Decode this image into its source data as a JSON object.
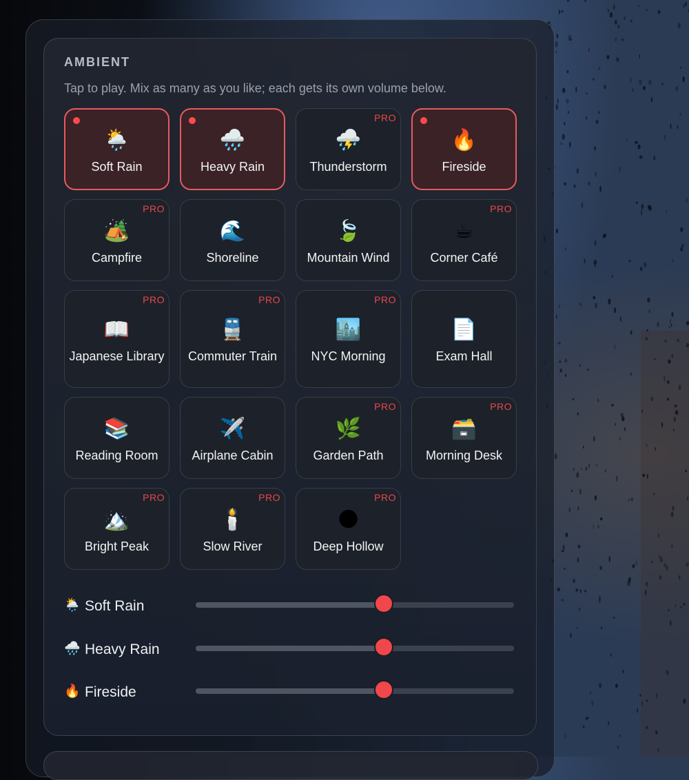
{
  "panel": {
    "title": "AMBIENT",
    "subtitle": "Tap to play. Mix as many as you like; each gets its own volume below."
  },
  "tiles": [
    {
      "emoji": "🌦️",
      "icon": "sun-rain-icon",
      "name": "Soft Rain",
      "active": true,
      "pro": false
    },
    {
      "emoji": "🌧️",
      "icon": "rain-cloud-icon",
      "name": "Heavy Rain",
      "active": true,
      "pro": false
    },
    {
      "emoji": "⛈️",
      "icon": "thunder-cloud-icon",
      "name": "Thunderstorm",
      "active": false,
      "pro": true
    },
    {
      "emoji": "🔥",
      "icon": "fire-icon",
      "name": "Fireside",
      "active": true,
      "pro": false
    },
    {
      "emoji": "🏕️",
      "icon": "camping-icon",
      "name": "Campfire",
      "active": false,
      "pro": true
    },
    {
      "emoji": "🌊",
      "icon": "wave-icon",
      "name": "Shoreline",
      "active": false,
      "pro": false
    },
    {
      "emoji": "🍃",
      "icon": "leaves-icon",
      "name": "Mountain Wind",
      "active": false,
      "pro": false
    },
    {
      "emoji": "☕",
      "icon": "coffee-icon",
      "name": "Corner Café",
      "active": false,
      "pro": true
    },
    {
      "emoji": "📖",
      "icon": "book-icon",
      "name": "Japanese Library",
      "active": false,
      "pro": true
    },
    {
      "emoji": "🚆",
      "icon": "train-icon",
      "name": "Commuter Train",
      "active": false,
      "pro": true
    },
    {
      "emoji": "🏙️",
      "icon": "cityscape-icon",
      "name": "NYC Morning",
      "active": false,
      "pro": true
    },
    {
      "emoji": "📄",
      "icon": "page-icon",
      "name": "Exam Hall",
      "active": false,
      "pro": false
    },
    {
      "emoji": "📚",
      "icon": "books-icon",
      "name": "Reading Room",
      "active": false,
      "pro": false
    },
    {
      "emoji": "✈️",
      "icon": "airplane-icon",
      "name": "Airplane Cabin",
      "active": false,
      "pro": false
    },
    {
      "emoji": "🌿",
      "icon": "herb-icon",
      "name": "Garden Path",
      "active": false,
      "pro": true
    },
    {
      "emoji": "🗃️",
      "icon": "card-box-icon",
      "name": "Morning Desk",
      "active": false,
      "pro": true
    },
    {
      "emoji": "🏔️",
      "icon": "mountain-icon",
      "name": "Bright Peak",
      "active": false,
      "pro": true
    },
    {
      "emoji": "🕯️",
      "icon": "candle-icon",
      "name": "Slow River",
      "active": false,
      "pro": true
    },
    {
      "emoji": "🌑",
      "icon": "new-moon-icon",
      "name": "Deep Hollow",
      "active": false,
      "pro": true
    }
  ],
  "pro_label": "PRO",
  "sliders": [
    {
      "emoji": "🌦️",
      "icon": "sun-rain-icon",
      "label": "Soft Rain",
      "value": 0.59
    },
    {
      "emoji": "🌧️",
      "icon": "rain-cloud-icon",
      "label": "Heavy Rain",
      "value": 0.59
    },
    {
      "emoji": "🔥",
      "icon": "fire-icon",
      "label": "Fireside",
      "value": 0.59
    }
  ],
  "colors": {
    "accent": "#f0474c",
    "active_border": "#e85a5f",
    "active_bg": "#3a2227",
    "pro": "#e8484d"
  }
}
